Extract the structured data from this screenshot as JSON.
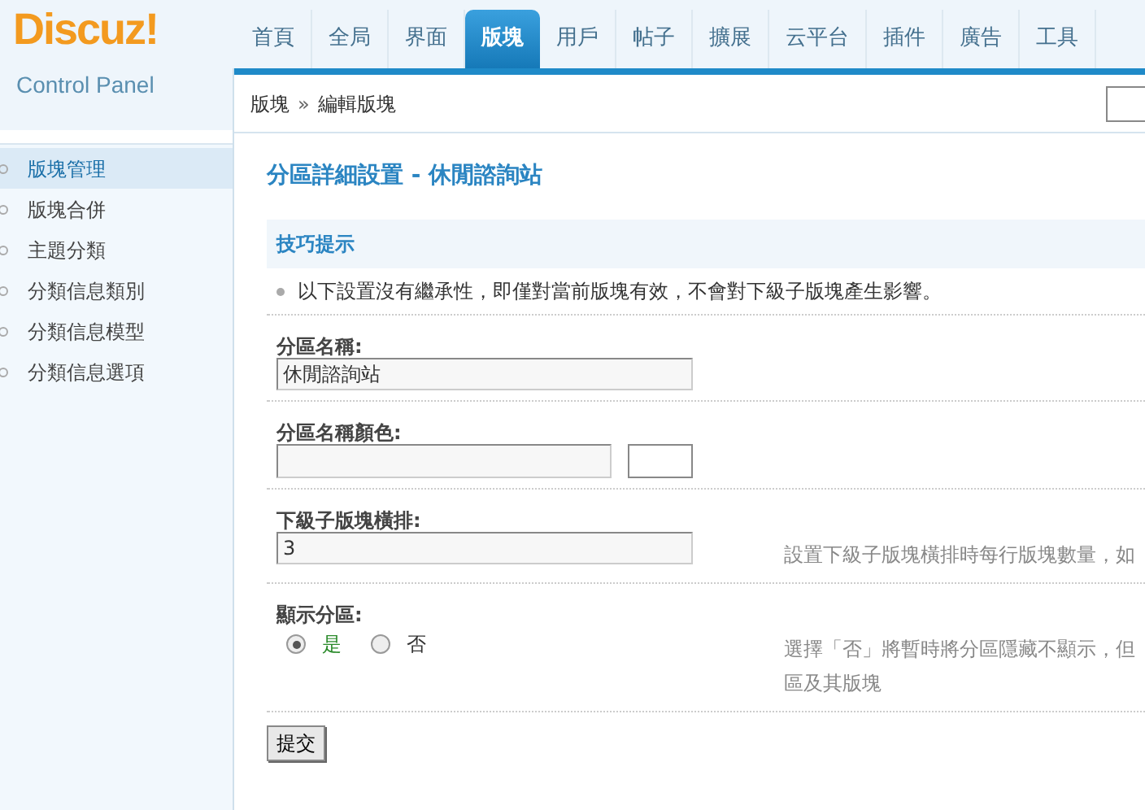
{
  "logo": {
    "brand": "Discuz!",
    "subtitle": "Control Panel"
  },
  "nav": [
    {
      "label": "首頁",
      "selected": false
    },
    {
      "label": "全局",
      "selected": false
    },
    {
      "label": "界面",
      "selected": false
    },
    {
      "label": "版塊",
      "selected": true
    },
    {
      "label": "用戶",
      "selected": false
    },
    {
      "label": "帖子",
      "selected": false
    },
    {
      "label": "擴展",
      "selected": false
    },
    {
      "label": "云平台",
      "selected": false
    },
    {
      "label": "插件",
      "selected": false
    },
    {
      "label": "廣告",
      "selected": false
    },
    {
      "label": "工具",
      "selected": false
    }
  ],
  "breadcrumb": [
    "版塊",
    "»",
    "編輯版塊"
  ],
  "sidebar": [
    {
      "label": "版塊管理",
      "selected": true
    },
    {
      "label": "版塊合併",
      "selected": false
    },
    {
      "label": "主題分類",
      "selected": false
    },
    {
      "label": "分類信息類別",
      "selected": false
    },
    {
      "label": "分類信息模型",
      "selected": false
    },
    {
      "label": "分類信息選項",
      "selected": false
    }
  ],
  "page_title": "分區詳細設置 - 休閒諮詢站",
  "tips": {
    "title": "技巧提示",
    "items": [
      "以下設置沒有繼承性，即僅對當前版塊有效，不會對下級子版塊產生影響。"
    ]
  },
  "fields": [
    {
      "kind": "text",
      "label": "分區名稱:",
      "value": "休閒諮詢站"
    },
    {
      "kind": "color",
      "label": "分區名稱顏色:"
    },
    {
      "kind": "text",
      "label": "下級子版塊橫排:",
      "value": "3",
      "hint": [
        "設置下級子版塊橫排時每行版塊數量，如"
      ]
    },
    {
      "kind": "radio",
      "label": "顯示分區:",
      "options": [
        {
          "label": "是",
          "selected": true
        },
        {
          "label": "否",
          "selected": false
        }
      ],
      "hint": [
        "選擇「否」將暫時將分區隱藏不顯示，但",
        "區及其版塊"
      ]
    }
  ],
  "submit": "提交"
}
